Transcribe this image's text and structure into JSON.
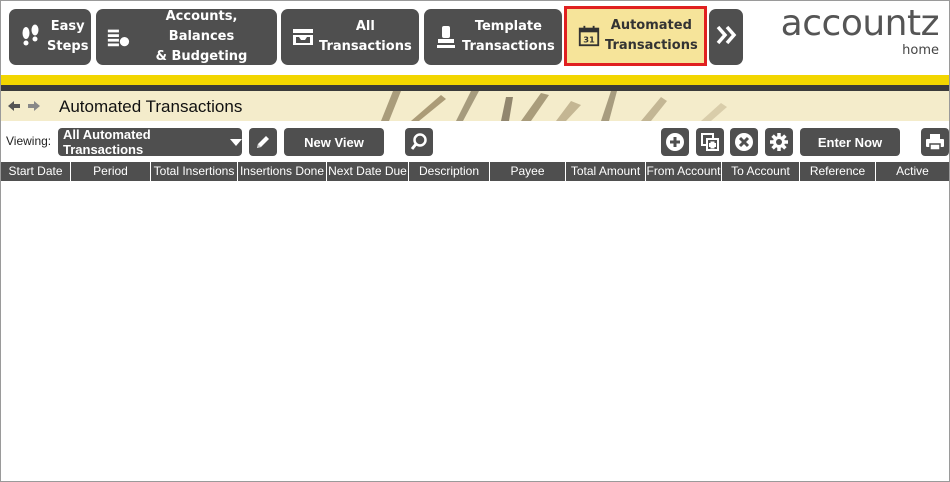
{
  "nav": {
    "buttons": [
      {
        "label": "Easy\nSteps",
        "icon": "footprints-icon"
      },
      {
        "label": "Accounts, Balances\n& Budgeting",
        "icon": "coins-icon"
      },
      {
        "label": "All\nTransactions",
        "icon": "inbox-tray-icon"
      },
      {
        "label": "Template\nTransactions",
        "icon": "stamp-icon"
      },
      {
        "label": "Automated\nTransactions",
        "icon": "calendar-31-icon",
        "calendar_number": "31",
        "active": true
      }
    ],
    "more_icon": "double-chevron-right-icon"
  },
  "logo": {
    "name": "accountz",
    "sub": "home"
  },
  "banner": {
    "title": "Automated Transactions",
    "back_icon": "arrow-left-icon",
    "forward_icon": "arrow-right-icon"
  },
  "toolbar": {
    "viewing_label": "Viewing:",
    "view_select": "All Automated Transactions",
    "new_view_label": "New View",
    "enter_now_label": "Enter Now"
  },
  "table": {
    "columns": [
      "Start Date",
      "Period",
      "Total Insertions",
      "Insertions Done",
      "Next Date Due",
      "Description",
      "Payee",
      "Total Amount",
      "From Account",
      "To Account",
      "Reference",
      "Active"
    ],
    "rows": []
  },
  "colors": {
    "dark_button": "#4f4f4f",
    "accent_yellow": "#f2d600",
    "active_highlight": "#f6e49a",
    "active_border": "#e02020"
  }
}
